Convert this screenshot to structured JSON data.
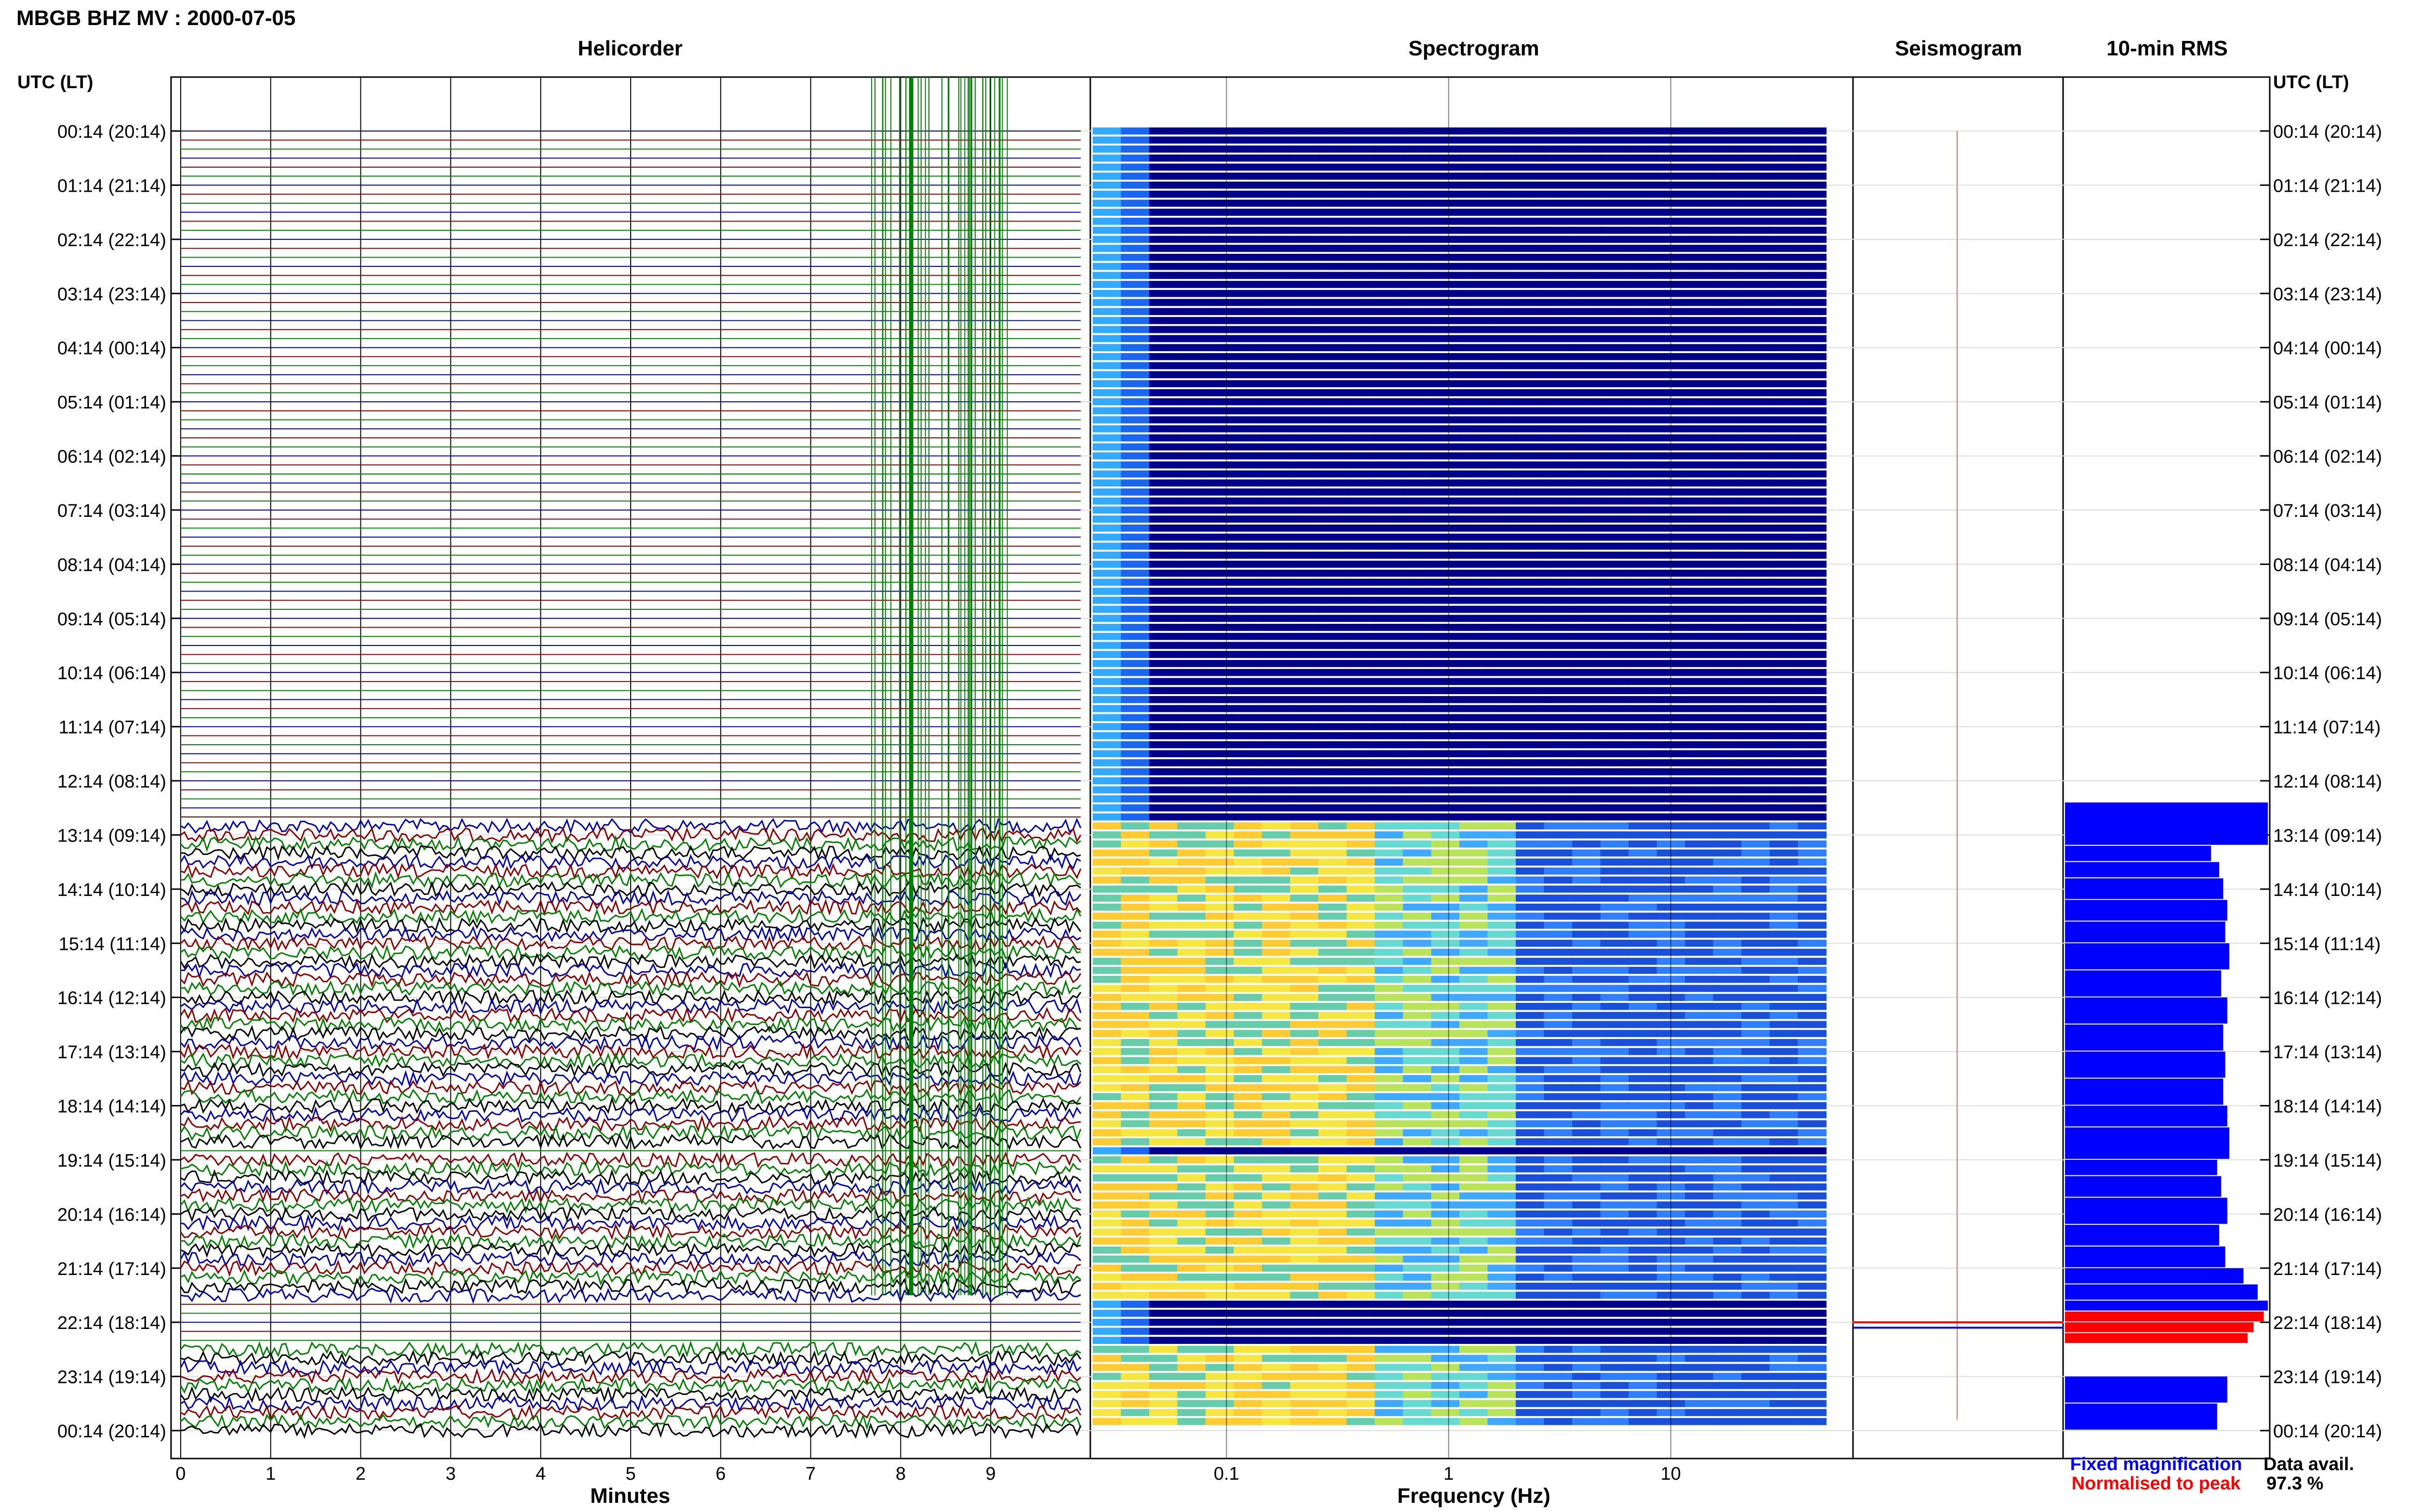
{
  "page": {
    "title": "MBGB BHZ MV : 2000-07-05",
    "panel_titles": {
      "helicorder": "Helicorder",
      "spectrogram": "Spectrogram",
      "seismogram": "Seismogram",
      "rms": "10-min RMS"
    },
    "axis_header_left": "UTC (LT)",
    "axis_header_right": "UTC (LT)",
    "legend": {
      "fixed": "Fixed magnification",
      "normalised": "Normalised to peak",
      "fixed_color": "#0000ff",
      "normalised_color": "#ff0000"
    },
    "data_avail": {
      "label": "Data avail.",
      "value": "97.3 %"
    }
  },
  "chart_data": [
    {
      "type": "line",
      "name": "helicorder",
      "title": "Helicorder",
      "xlabel": "Minutes",
      "ylabel": "UTC (LT)",
      "xlim": [
        0,
        10
      ],
      "x_ticks": [
        "0",
        "1",
        "2",
        "3",
        "4",
        "5",
        "6",
        "7",
        "8",
        "9"
      ],
      "time_ticks": [
        "00:14 (20:14)",
        "01:14 (21:14)",
        "02:14 (22:14)",
        "03:14 (23:14)",
        "04:14 (00:14)",
        "05:14 (01:14)",
        "06:14 (02:14)",
        "07:14 (03:14)",
        "08:14 (04:14)",
        "09:14 (05:14)",
        "10:14 (06:14)",
        "11:14 (07:14)",
        "12:14 (08:14)",
        "13:14 (09:14)",
        "14:14 (10:14)",
        "15:14 (11:14)",
        "16:14 (12:14)",
        "17:14 (13:14)",
        "18:14 (14:14)",
        "19:14 (15:14)",
        "20:14 (16:14)",
        "21:14 (17:14)",
        "22:14 (18:14)",
        "23:14 (19:14)",
        "00:14 (20:14)"
      ],
      "trace_colors": [
        "#000000",
        "#0000aa",
        "#880000",
        "#008000"
      ],
      "quiet_rows_end_hour": 12.5,
      "noisy_segments_hours": [
        [
          12.8,
          18.7
        ],
        [
          19.0,
          21.6
        ],
        [
          22.4,
          24.0
        ]
      ],
      "grid": true
    },
    {
      "type": "heatmap",
      "name": "spectrogram",
      "title": "Spectrogram",
      "xlabel": "Frequency (Hz)",
      "x_scale": "log",
      "xlim": [
        0.025,
        50
      ],
      "x_ticks": [
        "0.1",
        "1",
        "10"
      ],
      "grid": true
    },
    {
      "type": "line",
      "name": "seismogram",
      "title": "Seismogram",
      "grid": true
    },
    {
      "type": "bar",
      "name": "rms",
      "title": "10-min RMS",
      "orientation": "horizontal",
      "units": "relative",
      "hours": [
        12.4,
        13.2,
        13.5,
        13.8,
        14.2,
        14.6,
        15.0,
        15.5,
        16.0,
        16.5,
        17.0,
        17.5,
        18.0,
        18.4,
        19.0,
        19.3,
        19.7,
        20.2,
        20.6,
        21.0,
        21.3,
        21.6,
        21.8,
        22.0,
        22.2,
        22.4,
        23.0,
        23.5,
        24.0
      ],
      "values": [
        1.0,
        0.72,
        0.76,
        0.78,
        0.8,
        0.79,
        0.81,
        0.77,
        0.8,
        0.78,
        0.79,
        0.78,
        0.8,
        0.81,
        0.75,
        0.77,
        0.8,
        0.76,
        0.79,
        0.88,
        0.95,
        1.0,
        0.98,
        0.93,
        0.9,
        0.0,
        0.8,
        0.75,
        0.7
      ],
      "red_hours": [
        21.8,
        22.0,
        22.2
      ]
    }
  ]
}
